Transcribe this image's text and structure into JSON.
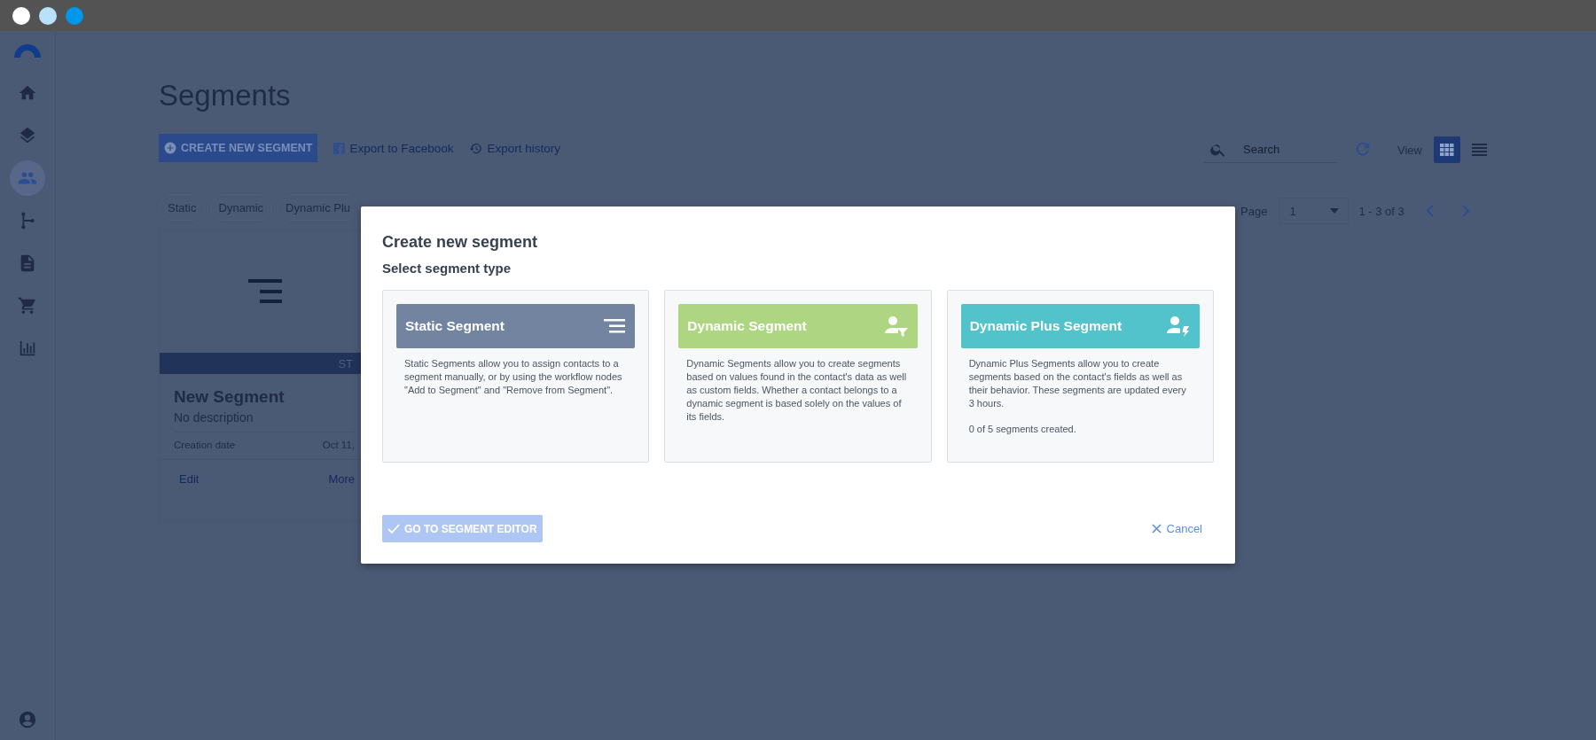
{
  "window_controls": [
    {
      "color": "#ffffff"
    },
    {
      "color": "#b9e1fa"
    },
    {
      "color": "#0096eb"
    }
  ],
  "sidebar": {
    "items": [
      {
        "kind": "home",
        "selected": false
      },
      {
        "kind": "layers",
        "selected": false
      },
      {
        "kind": "people",
        "selected": true
      },
      {
        "kind": "flow",
        "selected": false
      },
      {
        "kind": "document",
        "selected": false
      },
      {
        "kind": "cart",
        "selected": false
      },
      {
        "kind": "chart",
        "selected": false
      }
    ]
  },
  "page": {
    "title": "Segments",
    "create_button": "CREATE NEW SEGMENT",
    "links": [
      {
        "kind": "facebook",
        "label": "Export to Facebook"
      },
      {
        "kind": "history",
        "label": "Export history"
      }
    ],
    "search": {
      "placeholder": "Search"
    },
    "view": {
      "label": "View",
      "options": [
        {
          "kind": "grid",
          "selected": true
        },
        {
          "kind": "list",
          "selected": false
        }
      ]
    },
    "filters": [
      "Static",
      "Dynamic",
      "Dynamic Plu"
    ],
    "pagination": {
      "label": "Page",
      "value": "1",
      "range": "1 - 3 of 3"
    },
    "card": {
      "band": "ST",
      "name": "New Segment",
      "description": "No description",
      "date_label": "Creation date",
      "date_value": "Oct 11,",
      "actions": [
        "Edit",
        "More"
      ]
    }
  },
  "modal": {
    "title": "Create new segment",
    "subtitle": "Select segment type",
    "types": [
      {
        "kind": "static",
        "title": "Static Segment",
        "color": "#7284a0",
        "description": "Static Segments allow you to assign contacts to a segment manually, or by using the workflow nodes \"Add to Segment\" and \"Remove from Segment\"."
      },
      {
        "kind": "dynamic",
        "title": "Dynamic Segment",
        "color": "#aed581",
        "description": "Dynamic Segments allow you to create segments based on values found in the contact's data as well as custom fields. Whether a contact belongs to a dynamic segment is based solely on the values of its fields."
      },
      {
        "kind": "dynamic_plus",
        "title": "Dynamic Plus Segment",
        "color": "#53c3cb",
        "description": "Dynamic Plus Segments allow you to create segments based on the contact's fields as well as their behavior. These segments are updated every 3 hours.",
        "note": "0 of 5 segments created."
      }
    ],
    "primary_button": {
      "label": "GO TO SEGMENT EDITOR",
      "disabled": true
    },
    "cancel": "Cancel"
  }
}
